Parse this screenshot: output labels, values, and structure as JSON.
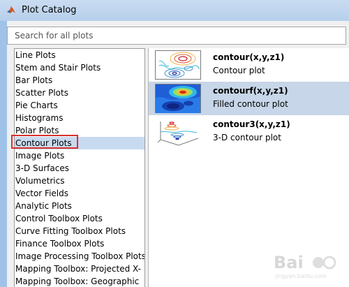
{
  "window": {
    "title": "Plot Catalog"
  },
  "search": {
    "placeholder": "Search for all plots"
  },
  "categories": [
    "Line Plots",
    "Stem and Stair Plots",
    "Bar Plots",
    "Scatter Plots",
    "Pie Charts",
    "Histograms",
    "Polar Plots",
    "Contour Plots",
    "Image Plots",
    "3-D Surfaces",
    "Volumetrics",
    "Vector Fields",
    "Analytic Plots",
    "Control Toolbox Plots",
    "Curve Fitting Toolbox Plots",
    "Finance Toolbox Plots",
    "Image Processing Toolbox Plots",
    "Mapping Toolbox: Projected X-",
    "Mapping Toolbox: Geographic"
  ],
  "selected_category": "Contour Plots",
  "plots": [
    {
      "name": "contour(x,y,z1)",
      "description": "Contour plot",
      "icon": "contour-thumbnail-icon"
    },
    {
      "name": "contourf(x,y,z1)",
      "description": "Filled contour plot",
      "icon": "filled-contour-thumbnail-icon"
    },
    {
      "name": "contour3(x,y,z1)",
      "description": "3-D contour plot",
      "icon": "contour3-thumbnail-icon"
    }
  ],
  "selected_plot": "contourf(x,y,z1)",
  "watermark": {
    "text": "Bai",
    "subtext": "jingyan.baidu.com"
  },
  "colors": {
    "selection": "#c8daf0",
    "highlight_box": "#d9302d",
    "titlebar": "#c9dcf1"
  }
}
